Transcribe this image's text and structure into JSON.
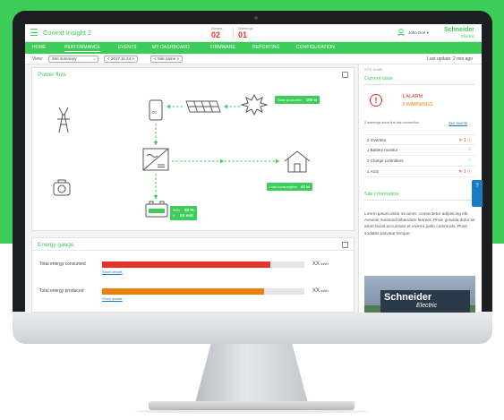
{
  "app": {
    "title": "Conext Insight 2"
  },
  "header": {
    "alarms_label": "Alarms",
    "alarms_count": "02",
    "warnings_label": "Warnings",
    "warnings_count": "01",
    "user": "John Doe",
    "logo_top": "Schneider",
    "logo_bottom": "Electric"
  },
  "nav": {
    "items": [
      {
        "label": "HOME"
      },
      {
        "label": "PERFORMANCE"
      },
      {
        "label": "EVENTS"
      },
      {
        "label": "MY DASHBOARD"
      },
      {
        "label": "FIRMWARE"
      },
      {
        "label": "REPORTING"
      },
      {
        "label": "CONFIGURATION"
      }
    ],
    "active": "PERFORMANCE"
  },
  "toolbar": {
    "view_label": "View:",
    "view_value": "Site summary",
    "date_value": "< 2017.11.24 >",
    "site_value": "< Site name >",
    "last_update": "Last update: 2 min ago"
  },
  "power_flow": {
    "title": "Power flow",
    "charge_controller_label": "cc",
    "solar_label": "Solar production",
    "solar_value": "108 w",
    "load_label": "Load consumption",
    "load_value": "47 w",
    "soc_label": "SOC",
    "soc_value": "62 %",
    "soc_v_label": "V",
    "soc_v_value": "XX volt"
  },
  "energy_gauge": {
    "title": "Energy gauge",
    "rows": [
      {
        "label": "Total energy consumed",
        "link": "Show details",
        "value": "XX",
        "unit": "kWh",
        "fill": 0.83,
        "color": "#e5332a"
      },
      {
        "label": "Total energy produced",
        "link": "Show details",
        "value": "XX",
        "unit": "kWh",
        "fill": 0.8,
        "color": "#e8810c"
      }
    ]
  },
  "side": {
    "site_name": "SITE NAME",
    "current_state_title": "Current state",
    "alarm_line": "1 ALARM",
    "warning_line": "2 WARNINGS",
    "warnings_note": "2 warnings since the last connection",
    "see_events": "See events",
    "devices": [
      {
        "name": "2 Inverters",
        "status": "✕ 1 ⓘ",
        "status_color": "#e5332a"
      },
      {
        "name": "1 Battery monitor",
        "status": "✓",
        "status_color": "#3dcd58"
      },
      {
        "name": "2 Charge controllers",
        "status": "✓",
        "status_color": "#3dcd58"
      },
      {
        "name": "1 AGS",
        "status": "✕ 1 ⓘ",
        "status_color": "#e5332a"
      }
    ],
    "site_info_title": "Site information",
    "site_info_text": "Lorem ipsum dolor sit amet, consectetur adipiscing elit. Aenean euismod bibendum laoreet. Proin gravida dolor sit amet lacus accumsan et viverra justo commodo. Proin sodales pulvinar tempor.",
    "image_logo_top": "Schneider",
    "image_logo_bottom": "Electric"
  },
  "help_tab": "?",
  "colors": {
    "brand": "#3dcd58",
    "alarm": "#e5332a",
    "link": "#1a7dc4"
  }
}
